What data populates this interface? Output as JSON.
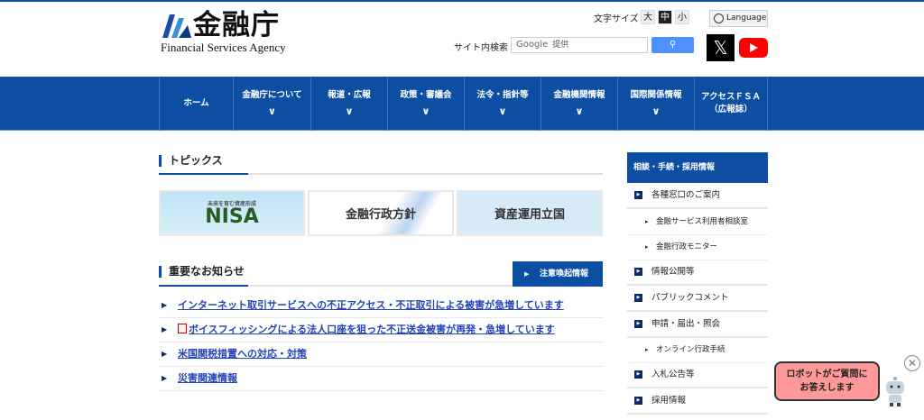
{
  "header": {
    "logo_kanji": "金融庁",
    "logo_en": "Financial Services Agency",
    "font_size_label": "文字サイズ",
    "font_sizes": [
      "大",
      "中",
      "小"
    ],
    "font_size_selected": "中",
    "language": "Language",
    "search_label": "サイト内検索",
    "search_placeholder_brand": "Google",
    "search_placeholder": "提供",
    "x_label": "𝕏"
  },
  "nav": [
    {
      "label": "ホーム"
    },
    {
      "label": "金融庁について"
    },
    {
      "label": "報道・広報"
    },
    {
      "label": "政策・審議会"
    },
    {
      "label": "法令・指針等"
    },
    {
      "label": "金融機関情報"
    },
    {
      "label": "国際関係情報"
    },
    {
      "label": "アクセスＦＳＡ",
      "label2": "（広報誌）"
    }
  ],
  "topics": {
    "title": "トピックス",
    "banners": [
      {
        "small": "未来を育む資産形成",
        "label": "NISA"
      },
      {
        "label": "金融行政方針"
      },
      {
        "label": "資産運用立国"
      }
    ]
  },
  "notices": {
    "title": "重要なお知らせ",
    "alert_button": "注意喚起情報",
    "items": [
      {
        "text": "インターネット取引サービスへの不正アクセス・不正取引による被害が急増しています"
      },
      {
        "text": "ボイスフィッシングによる法人口座を狙った不正送金被害が再発・急増しています",
        "pdf": true
      },
      {
        "text": "米国関税措置への対応・対策"
      },
      {
        "text": "災害関連情報"
      }
    ]
  },
  "sidebar": {
    "title": "相談・手続・採用情報",
    "items": [
      {
        "label": "各種窓口のご案内",
        "sub": false
      },
      {
        "label": "金融サービス利用者相談室",
        "sub": true
      },
      {
        "label": "金融行政モニター",
        "sub": true
      },
      {
        "label": "情報公開等",
        "sub": false
      },
      {
        "label": "パブリックコメント",
        "sub": false
      },
      {
        "label": "申請・届出・照会",
        "sub": false
      },
      {
        "label": "オンライン行政手続",
        "sub": true
      },
      {
        "label": "入札公告等",
        "sub": false
      },
      {
        "label": "採用情報",
        "sub": false
      }
    ]
  },
  "chatbot": {
    "line1": "ロボットがご質問に",
    "line2": "お答えします"
  },
  "colors": {
    "brand": "#0b4ea2",
    "link": "#2343b8",
    "bubble": "#ff9999"
  }
}
